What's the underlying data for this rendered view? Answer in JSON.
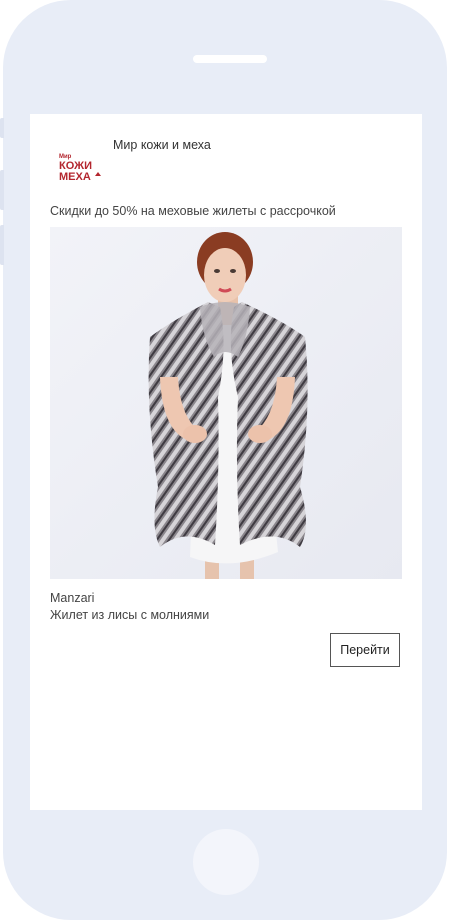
{
  "ad": {
    "advertiser": {
      "name": "Мир кожи и меха",
      "logo_text": [
        "Мир",
        "КОЖИ",
        "МЕХА"
      ]
    },
    "headline": "Скидки до 50% на меховые жилеты с рассрочкой",
    "product": {
      "image_icon": "fur-vest-photo",
      "brand": "Manzari",
      "title": "Жилет из лисы с молниями"
    },
    "cta_label": "Перейти"
  },
  "colors": {
    "phone_frame": "#e8edf7",
    "logo_red": "#b3262e",
    "text": "#444444"
  }
}
